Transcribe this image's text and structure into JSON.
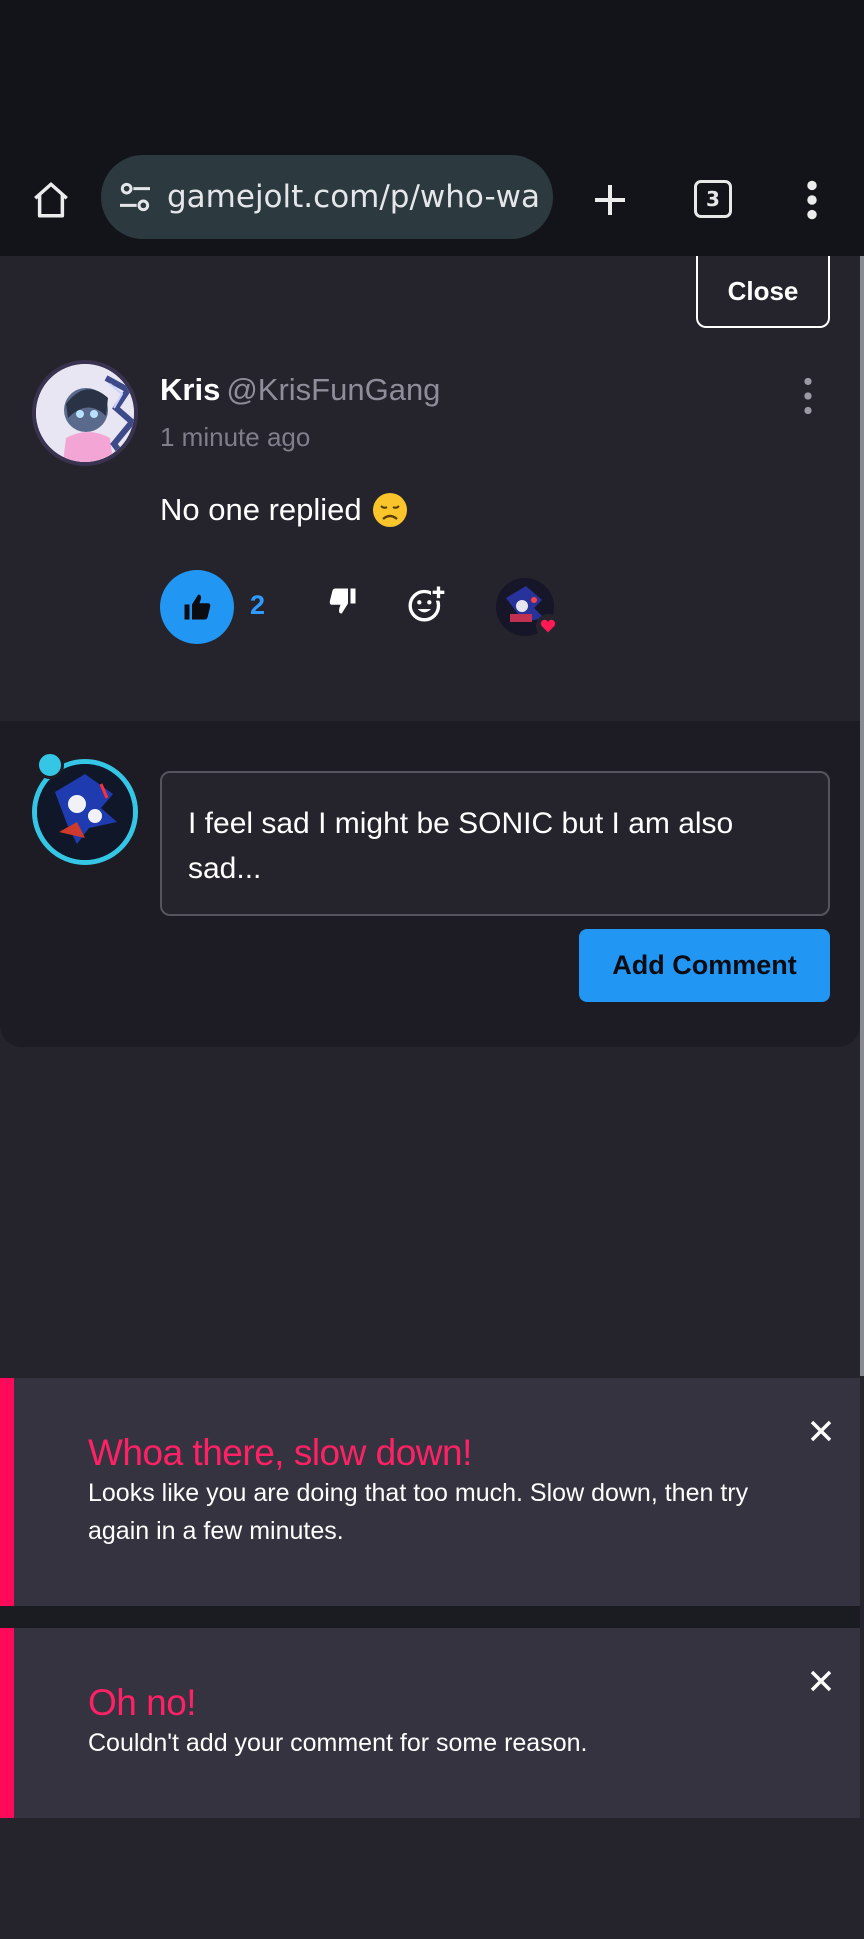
{
  "browser": {
    "url": "gamejolt.com/p/who-wa",
    "tab_count": "3"
  },
  "page": {
    "close_label": "Close",
    "comment": {
      "author_name": "Kris",
      "author_handle": "@KrisFunGang",
      "timestamp": "1 minute ago",
      "body": "No one replied",
      "like_count": "2"
    },
    "composer": {
      "reply_text": "I feel sad I might be SONIC but I am also sad...",
      "submit_label": "Add Comment"
    }
  },
  "growls": [
    {
      "title": "Whoa there, slow down!",
      "message": "Looks like you are doing that too much. Slow down, then try again in a few minutes."
    },
    {
      "title": "Oh no!",
      "message": "Couldn't add your comment for some reason."
    }
  ],
  "colors": {
    "accent_blue": "#2196f3",
    "error_pink": "#ff0a5a",
    "background": "#25242d"
  }
}
